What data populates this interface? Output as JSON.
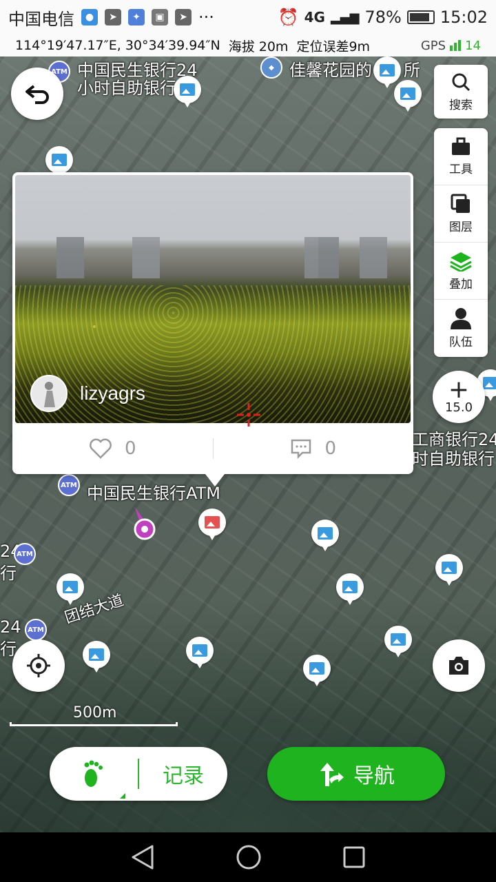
{
  "status_bar": {
    "carrier": "中国电信",
    "network": "4G",
    "battery": "78%",
    "time": "15:02",
    "extra": "···"
  },
  "coord_bar": {
    "coordinates": "114°19′47.17″E, 30°34′39.94″N",
    "altitude": "海拔 20m",
    "accuracy": "定位误差9m",
    "gps_label": "GPS",
    "satellites": "14"
  },
  "map": {
    "labels": {
      "bank_top": "中国民生银行24",
      "bank_top_2": "小时自助银行",
      "garden": "佳馨花园的",
      "garden_2": "所",
      "icbc": "工商银行24",
      "icbc_2": "时自助银行",
      "minsheng_atm": "中国民生银行ATM",
      "road": "团结大道",
      "left_24": "24",
      "left_hang": "行",
      "left_24b": "24",
      "left_hangb": "行"
    },
    "zoom": "15.0",
    "scale": "500m"
  },
  "toolbar": {
    "search": "搜索",
    "tools": "工具",
    "layers": "图层",
    "overlay": "叠加",
    "team": "队伍"
  },
  "popup": {
    "username": "lizyagrs",
    "likes": "0",
    "comments": "0"
  },
  "actions": {
    "record": "记录",
    "navigate": "导航"
  },
  "colors": {
    "accent_green": "#1fb41f",
    "pin_blue": "#3a9ae0",
    "atm_blue": "#5d6fd0"
  }
}
